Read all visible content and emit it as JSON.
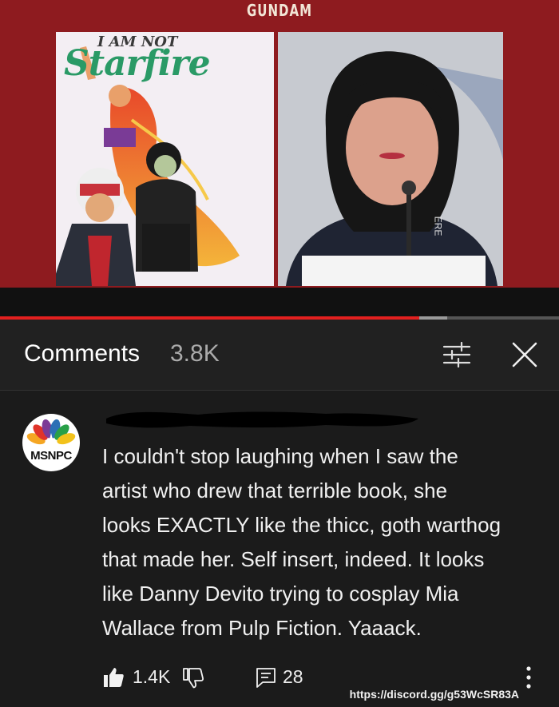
{
  "video": {
    "banner_text": "GUNDAM",
    "cover_title_top": "I AM NOT",
    "cover_title": "Starfire",
    "side_text": "ERE",
    "progress_percent": 75,
    "buffer_percent": 80
  },
  "comments_panel": {
    "title": "Comments",
    "count": "3.8K",
    "filter_icon": "sliders-icon",
    "close_icon": "close-icon"
  },
  "comment": {
    "avatar_label": "MSNPC",
    "avatar_colors": [
      "#f5a623",
      "#e0342a",
      "#7c3b96",
      "#2c6fb5",
      "#28a048",
      "#f2c21b"
    ],
    "text": "I couldn't stop laughing when I saw the\nartist who drew that terrible book, she\nlooks EXACTLY like the thicc, goth warthog\nthat made her. Self insert, indeed. It looks\nlike Danny Devito trying to cosplay Mia\nWallace from Pulp Fiction. Yaaack.",
    "likes": "1.4K",
    "replies": "28",
    "like_icon": "thumbs-up-icon",
    "dislike_icon": "thumbs-down-icon",
    "reply_icon": "reply-icon",
    "more_icon": "more-vert-icon"
  },
  "watermark": "https://discord.gg/g53WcSR83A"
}
